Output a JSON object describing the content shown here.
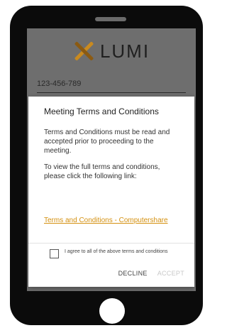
{
  "app": {
    "logo_text": "LUMI",
    "colors": {
      "accent": "#d4900f",
      "screen_backdrop": "#6e6e6e",
      "device": "#0b0b0b"
    }
  },
  "login": {
    "meeting_id": "123-456-789"
  },
  "dialog": {
    "title": "Meeting Terms and Conditions",
    "body_1": "Terms and Conditions must be read and accepted prior to proceeding to the meeting.",
    "body_2": "To view the full terms and conditions, please click the following link:",
    "link_text": "Terms and Conditions - Computershare",
    "agree_label": "I agree to all of the above terms and conditions",
    "decline_label": "DECLINE",
    "accept_label": "ACCEPT"
  }
}
